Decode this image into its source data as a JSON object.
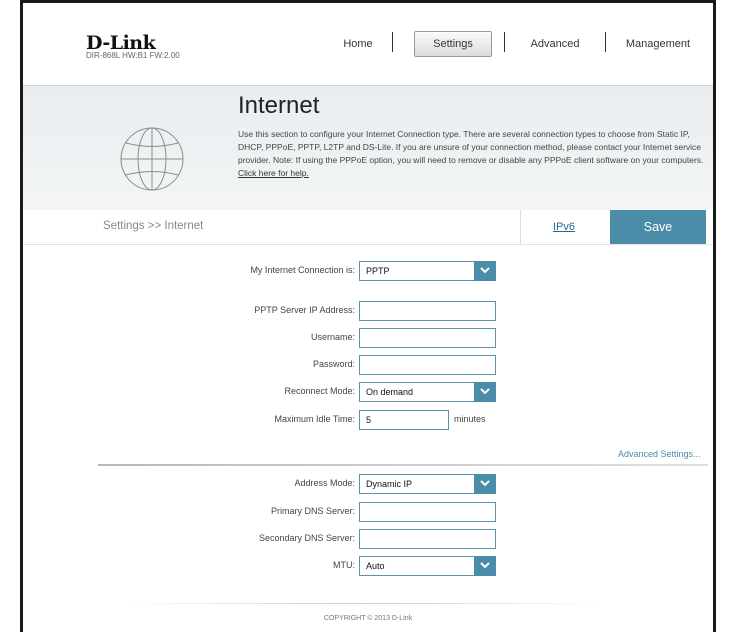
{
  "brand": {
    "logo": "D-Link",
    "model_line": "DIR-868L   HW:B1   FW:2.00"
  },
  "nav": {
    "home": "Home",
    "settings": "Settings",
    "advanced": "Advanced",
    "management": "Management"
  },
  "banner": {
    "title": "Internet",
    "description": "Use this section to configure your Internet Connection type. There are several connection types to choose from Static IP, DHCP, PPPoE, PPTP, L2TP and DS-Lite. If you are unsure of your connection method, please contact your Internet service provider. Note: If using the PPPoE option, you will need to remove or disable any PPPoE client software on your computers.",
    "help_link": "Click here for help."
  },
  "crumbbar": {
    "breadcrumb": "Settings >> Internet",
    "ipv6_link": "IPv6",
    "save_label": "Save"
  },
  "form": {
    "connection": {
      "label": "My Internet Connection is:",
      "value": "PPTP"
    },
    "server_ip": {
      "label": "PPTP Server IP Address:",
      "value": ""
    },
    "username": {
      "label": "Username:",
      "value": ""
    },
    "password": {
      "label": "Password:",
      "value": ""
    },
    "reconnect": {
      "label": "Reconnect Mode:",
      "value": "On demand"
    },
    "idle_time": {
      "label": "Maximum Idle Time:",
      "value": "5",
      "unit": "minutes"
    },
    "advanced_link": "Advanced Settings...",
    "address_mode": {
      "label": "Address Mode:",
      "value": "Dynamic IP"
    },
    "primary_dns": {
      "label": "Primary DNS Server:",
      "value": ""
    },
    "secondary_dns": {
      "label": "Secondary DNS Server:",
      "value": ""
    },
    "mtu": {
      "label": "MTU:",
      "value": "Auto"
    }
  },
  "footer": {
    "copyright": "COPYRIGHT © 2013 D-Link"
  },
  "colors": {
    "accent": "#4b8ca8",
    "field_border": "#5e92a8"
  }
}
